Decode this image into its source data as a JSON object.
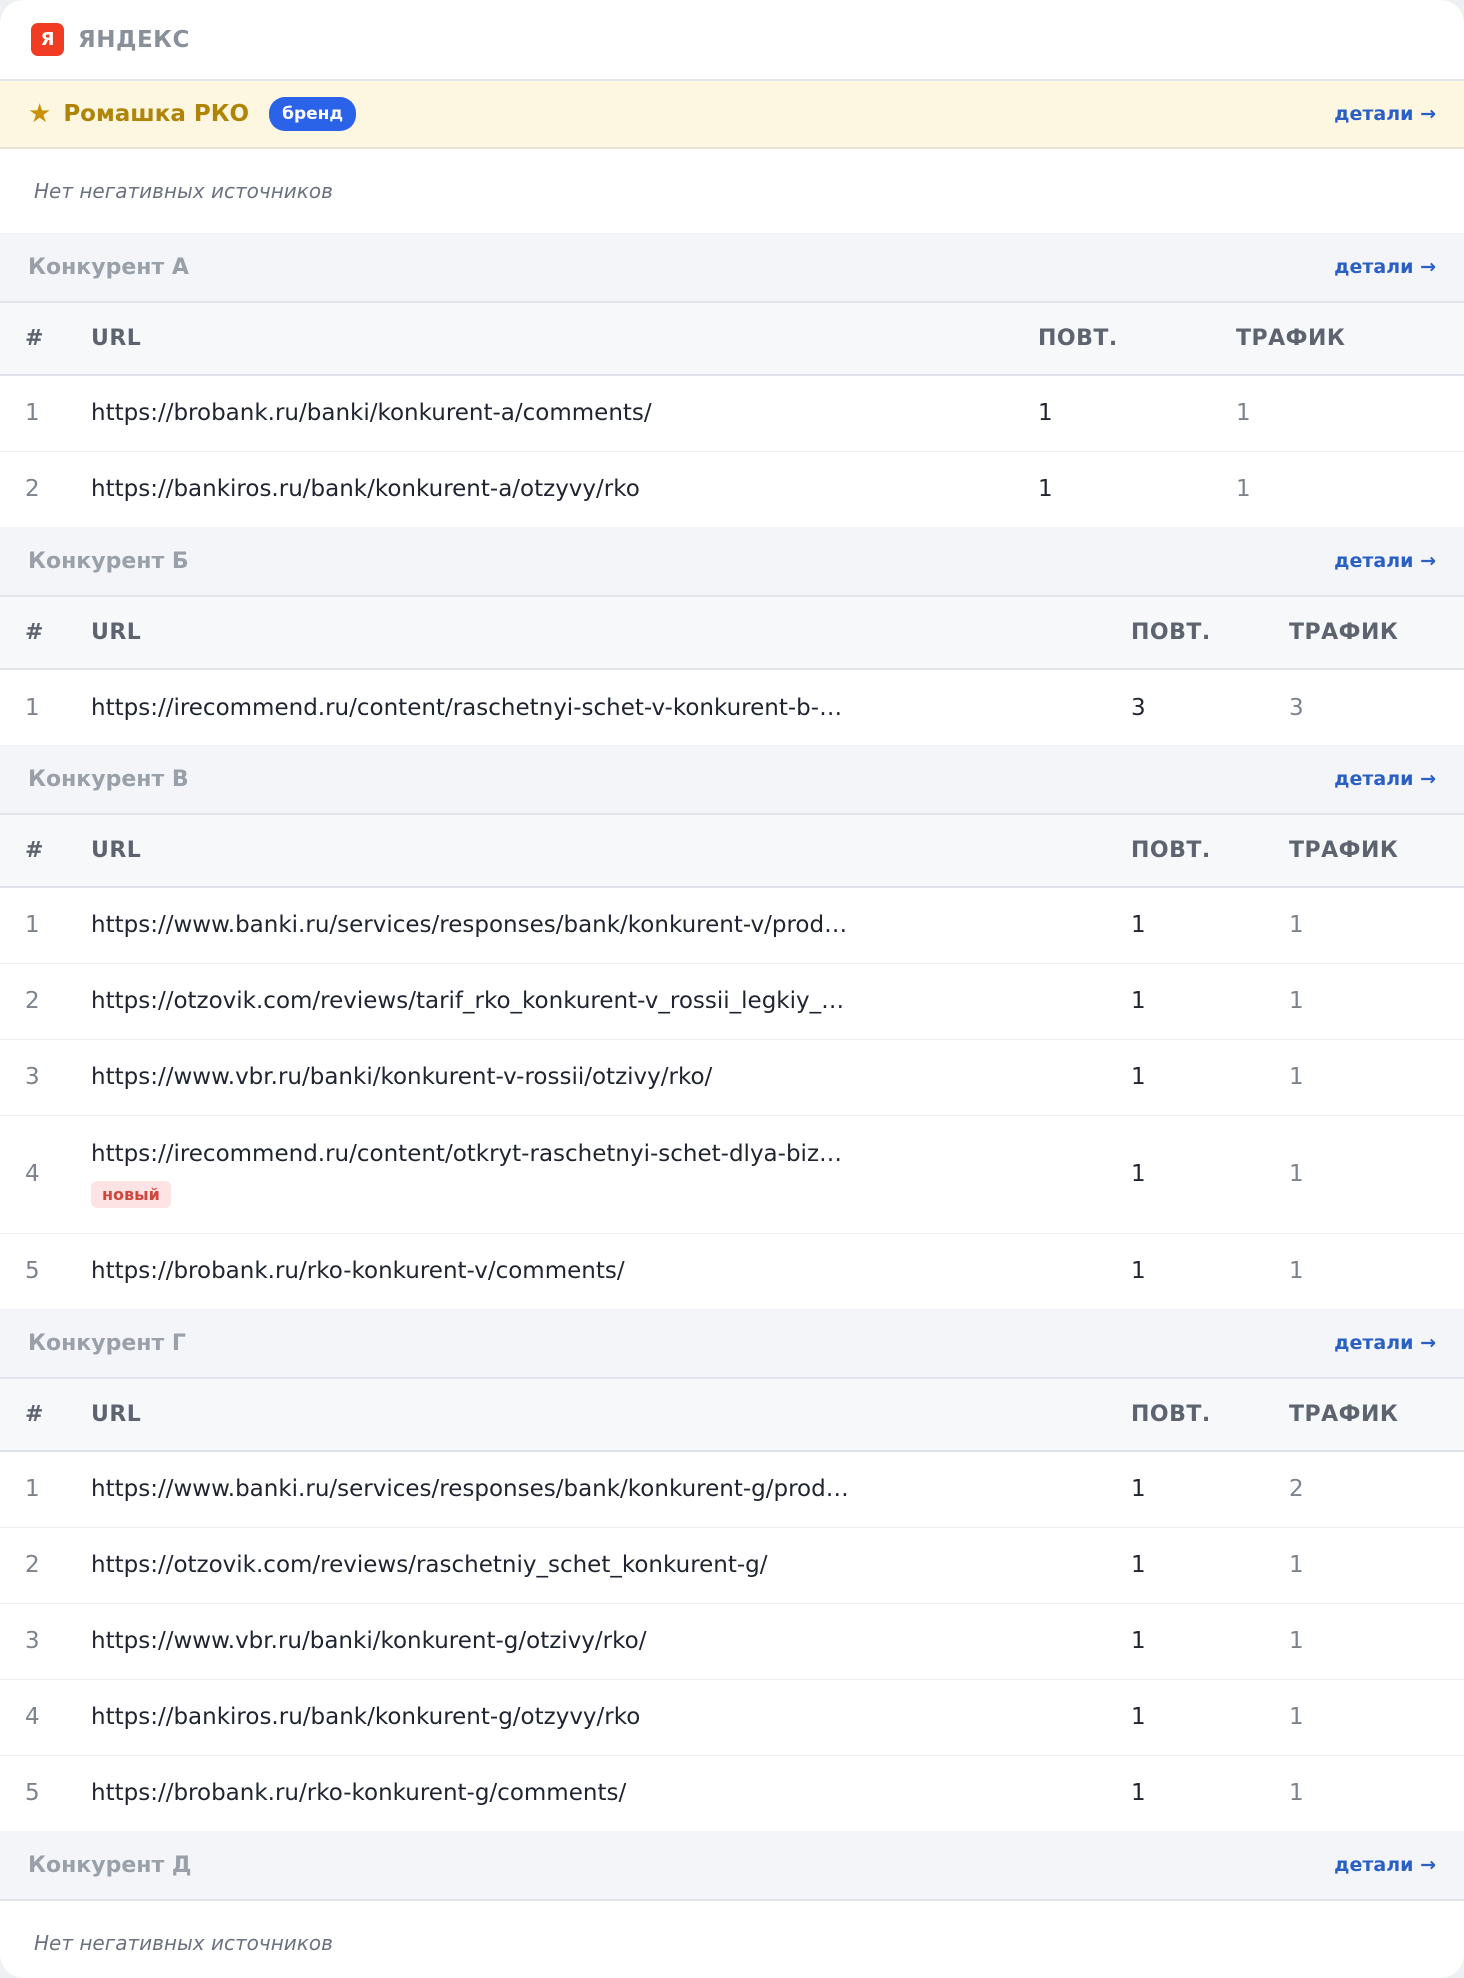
{
  "engine": {
    "logo": "Я",
    "name": "ЯНДЕКС"
  },
  "brand": {
    "name": "Ромашка РКО",
    "badge": "бренд",
    "details": "детали →",
    "empty": "Нет негативных источников"
  },
  "headers": {
    "num": "#",
    "url": "URL",
    "rep": "ПОВТ.",
    "traffic": "ТРАФИК"
  },
  "competitors": [
    {
      "name": "Конкурент А",
      "details": "детали →",
      "rows": [
        {
          "n": "1",
          "url": "https://brobank.ru/banki/konkurent-a/comments/",
          "rep": "1",
          "traffic": "1"
        },
        {
          "n": "2",
          "url": "https://bankiros.ru/bank/konkurent-a/otzyvy/rko",
          "rep": "1",
          "traffic": "1"
        }
      ]
    },
    {
      "name": "Конкурент Б",
      "details": "детали →",
      "rows": [
        {
          "n": "1",
          "url": "https://irecommend.ru/content/raschetnyi-schet-v-konkurent-b-ply…",
          "rep": "3",
          "traffic": "3"
        }
      ]
    },
    {
      "name": "Конкурент В",
      "details": "детали →",
      "rows": [
        {
          "n": "1",
          "url": "https://www.banki.ru/services/responses/bank/konkurent-v/produc…",
          "rep": "1",
          "traffic": "1"
        },
        {
          "n": "2",
          "url": "https://otzovik.com/reviews/tarif_rko_konkurent-v_rossii_legkiy_st…",
          "rep": "1",
          "traffic": "1"
        },
        {
          "n": "3",
          "url": "https://www.vbr.ru/banki/konkurent-v-rossii/otzivy/rko/",
          "rep": "1",
          "traffic": "1"
        },
        {
          "n": "4",
          "url": "https://irecommend.ru/content/otkryt-raschetnyi-schet-dlya-biznes…",
          "rep": "1",
          "traffic": "1",
          "badge": "новый"
        },
        {
          "n": "5",
          "url": "https://brobank.ru/rko-konkurent-v/comments/",
          "rep": "1",
          "traffic": "1"
        }
      ]
    },
    {
      "name": "Конкурент Г",
      "details": "детали →",
      "rows": [
        {
          "n": "1",
          "url": "https://www.banki.ru/services/responses/bank/konkurent-g/produc…",
          "rep": "1",
          "traffic": "2"
        },
        {
          "n": "2",
          "url": "https://otzovik.com/reviews/raschetniy_schet_konkurent-g/",
          "rep": "1",
          "traffic": "1"
        },
        {
          "n": "3",
          "url": "https://www.vbr.ru/banki/konkurent-g/otzivy/rko/",
          "rep": "1",
          "traffic": "1"
        },
        {
          "n": "4",
          "url": "https://bankiros.ru/bank/konkurent-g/otzyvy/rko",
          "rep": "1",
          "traffic": "1"
        },
        {
          "n": "5",
          "url": "https://brobank.ru/rko-konkurent-g/comments/",
          "rep": "1",
          "traffic": "1"
        }
      ]
    }
  ],
  "last_competitor": {
    "name": "Конкурент Д",
    "details": "детали →",
    "empty": "Нет негативных источников"
  }
}
